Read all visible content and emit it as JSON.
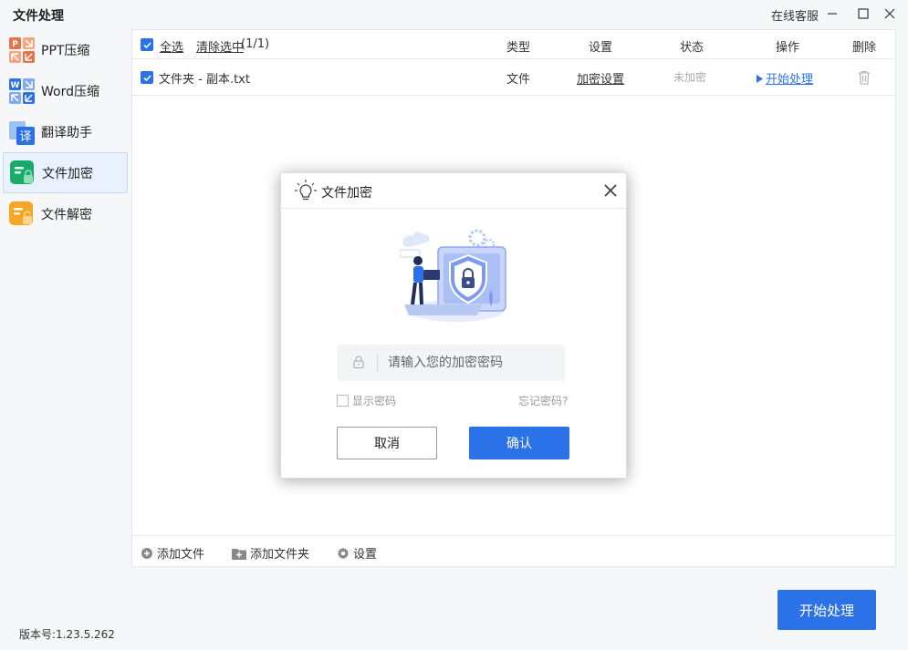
{
  "app": {
    "title": "文件处理",
    "service_label": "在线客服"
  },
  "sidebar": {
    "items": [
      {
        "label": "PPT压缩",
        "icon": "ppt-compress-icon",
        "active": false
      },
      {
        "label": "Word压缩",
        "icon": "word-compress-icon",
        "active": false
      },
      {
        "label": "翻译助手",
        "icon": "translate-icon",
        "active": false
      },
      {
        "label": "文件加密",
        "icon": "file-encrypt-icon",
        "active": true
      },
      {
        "label": "文件解密",
        "icon": "file-decrypt-icon",
        "active": false
      }
    ]
  },
  "table": {
    "select_all": "全选",
    "clear_selected": "清除选中",
    "count": "(1/1)",
    "columns": {
      "type": "类型",
      "settings": "设置",
      "status": "状态",
      "action": "操作",
      "delete": "删除"
    },
    "rows": [
      {
        "name": "文件夹 - 副本.txt",
        "type": "文件",
        "settings": "加密设置",
        "status": "未加密",
        "action": "开始处理"
      }
    ]
  },
  "footer": {
    "add_file": "添加文件",
    "add_folder": "添加文件夹",
    "settings": "设置"
  },
  "version": "版本号:1.23.5.262",
  "start_button": "开始处理",
  "modal": {
    "title": "文件加密",
    "password_placeholder": "请输入您的加密密码",
    "show_password": "显示密码",
    "forgot_password": "忘记密码?",
    "cancel": "取消",
    "confirm": "确认"
  },
  "colors": {
    "accent": "#2b72e8",
    "ppt": "#e8734a",
    "word": "#2b72e8",
    "encrypt": "#1aaa6a",
    "decrypt": "#f5a623"
  }
}
